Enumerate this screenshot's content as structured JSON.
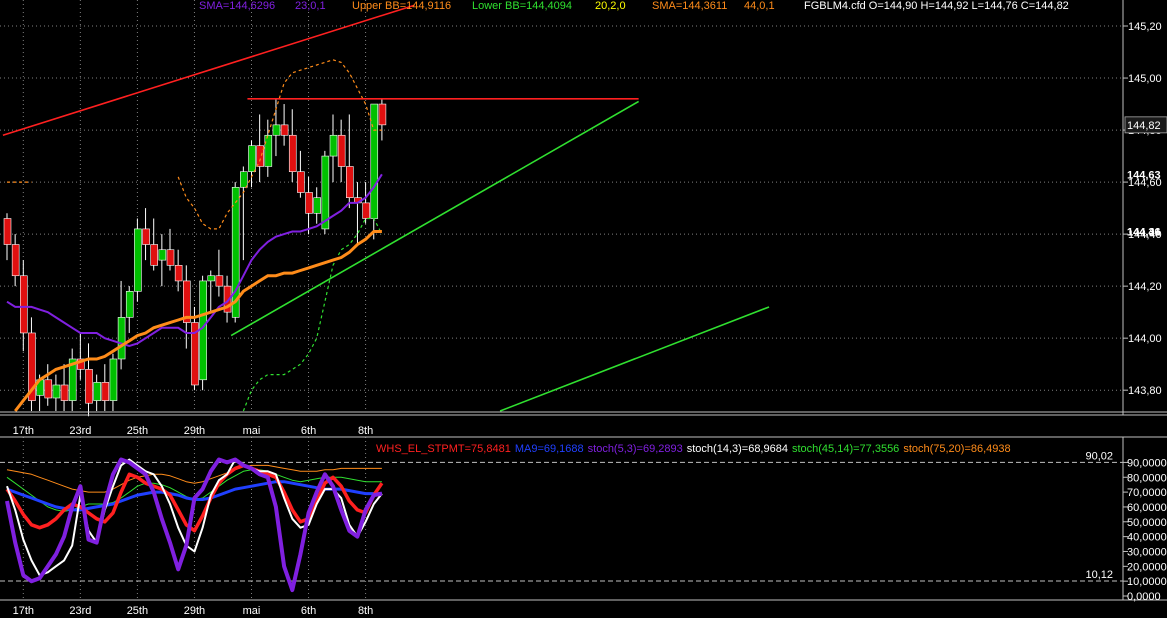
{
  "header": {
    "sma_label": "SMA=144,6296",
    "sma_params": "23,0,1",
    "upper_bb": "Upper BB=144,9116",
    "lower_bb": "Lower BB=144,4094",
    "bb_params": "20,2,0",
    "sma2_label": "SMA=144,3611",
    "sma2_params": "44,0,1",
    "quote": "FGBLM4.cfd O=144,90 H=144,92 L=144,76 C=144,82"
  },
  "colors": {
    "background": "#000000",
    "up_candle": "#00c000",
    "down_candle": "#e01010",
    "sma23": "#8020e0",
    "sma44": "#ff8c1a",
    "bollinger": "#ff8c1a",
    "trend_red": "#ff2020",
    "trend_green": "#30e030",
    "grid": "#808080"
  },
  "chart_data": [
    {
      "type": "candlestick",
      "instrument": "FGBLM4.cfd",
      "ylim": [
        143.72,
        145.3
      ],
      "y_ticks": [
        "145,20",
        "145,00",
        "144,80",
        "144,60",
        "144,40",
        "144,20",
        "144,00",
        "143,80"
      ],
      "x_tick_labels": [
        "17th",
        "23rd",
        "25th",
        "29th",
        "mai",
        "6th",
        "8th"
      ],
      "x_tick_index": [
        2,
        9,
        16,
        23,
        30,
        37,
        44
      ],
      "price_badges": [
        {
          "text": "144,82",
          "value": 144.82,
          "color": "#cccccc"
        },
        {
          "text": "144,63",
          "value": 144.63,
          "color": "#8020e0"
        },
        {
          "text": "144,36",
          "value": 144.41,
          "color": "#ff8c1a"
        },
        {
          "text": "144,41",
          "value": 144.41,
          "color": "#ff8c1a"
        }
      ],
      "ohlc": [
        [
          144.46,
          144.48,
          144.3,
          144.36
        ],
        [
          144.36,
          144.4,
          144.2,
          144.24
        ],
        [
          144.24,
          144.3,
          143.95,
          144.02
        ],
        [
          144.02,
          144.08,
          143.72,
          143.76
        ],
        [
          143.78,
          143.86,
          143.72,
          143.84
        ],
        [
          143.84,
          143.9,
          143.74,
          143.77
        ],
        [
          143.77,
          143.86,
          143.72,
          143.82
        ],
        [
          143.82,
          143.9,
          143.72,
          143.76
        ],
        [
          143.76,
          143.96,
          143.72,
          143.92
        ],
        [
          143.92,
          144.02,
          143.84,
          143.88
        ],
        [
          143.88,
          143.98,
          143.7,
          143.75
        ],
        [
          143.76,
          143.86,
          143.72,
          143.83
        ],
        [
          143.83,
          143.9,
          143.72,
          143.76
        ],
        [
          143.76,
          143.94,
          143.72,
          143.92
        ],
        [
          143.92,
          144.22,
          143.88,
          144.08
        ],
        [
          144.08,
          144.2,
          144.02,
          144.18
        ],
        [
          144.18,
          144.46,
          144.14,
          144.42
        ],
        [
          144.42,
          144.5,
          144.3,
          144.36
        ],
        [
          144.36,
          144.46,
          144.26,
          144.28
        ],
        [
          144.3,
          144.4,
          144.2,
          144.34
        ],
        [
          144.34,
          144.42,
          144.26,
          144.28
        ],
        [
          144.28,
          144.34,
          144.18,
          144.22
        ],
        [
          144.22,
          144.28,
          143.96,
          144.06
        ],
        [
          144.06,
          144.12,
          143.8,
          143.82
        ],
        [
          143.84,
          144.24,
          143.8,
          144.22
        ],
        [
          144.22,
          144.26,
          144.1,
          144.24
        ],
        [
          144.24,
          144.34,
          144.16,
          144.2
        ],
        [
          144.2,
          144.24,
          144.06,
          144.1
        ],
        [
          144.08,
          144.6,
          144.06,
          144.58
        ],
        [
          144.58,
          144.66,
          144.3,
          144.64
        ],
        [
          144.64,
          144.76,
          144.58,
          144.74
        ],
        [
          144.74,
          144.86,
          144.6,
          144.66
        ],
        [
          144.66,
          144.84,
          144.62,
          144.78
        ],
        [
          144.78,
          144.92,
          144.7,
          144.82
        ],
        [
          144.82,
          144.9,
          144.74,
          144.78
        ],
        [
          144.78,
          144.88,
          144.6,
          144.64
        ],
        [
          144.64,
          144.72,
          144.54,
          144.56
        ],
        [
          144.56,
          144.62,
          144.4,
          144.48
        ],
        [
          144.48,
          144.58,
          144.44,
          144.54
        ],
        [
          144.42,
          144.72,
          144.4,
          144.7
        ],
        [
          144.7,
          144.86,
          144.6,
          144.78
        ],
        [
          144.78,
          144.84,
          144.6,
          144.66
        ],
        [
          144.66,
          144.86,
          144.5,
          144.54
        ],
        [
          144.54,
          144.6,
          144.36,
          144.52
        ],
        [
          144.52,
          144.6,
          144.44,
          144.46
        ],
        [
          144.46,
          144.9,
          144.38,
          144.9
        ],
        [
          144.9,
          144.92,
          144.76,
          144.82
        ]
      ],
      "sma_23": [
        144.14,
        144.12,
        144.12,
        144.12,
        144.11,
        144.1,
        144.08,
        144.06,
        144.04,
        144.02,
        144.02,
        144.02,
        144.0,
        143.99,
        143.98,
        143.97,
        143.98,
        144.0,
        144.02,
        144.04,
        144.04,
        144.04,
        144.02,
        144.02,
        144.04,
        144.08,
        144.12,
        144.14,
        144.18,
        144.24,
        144.3,
        144.34,
        144.37,
        144.39,
        144.4,
        144.41,
        144.41,
        144.42,
        144.43,
        144.45,
        144.47,
        144.49,
        144.52,
        144.52,
        144.54,
        144.58,
        144.63
      ],
      "sma_44": [
        null,
        143.72,
        143.76,
        143.8,
        143.84,
        143.86,
        143.88,
        143.89,
        143.9,
        143.91,
        143.92,
        143.92,
        143.93,
        143.95,
        143.97,
        143.99,
        144.01,
        144.02,
        144.04,
        144.05,
        144.06,
        144.07,
        144.08,
        144.08,
        144.09,
        144.1,
        144.11,
        144.12,
        144.14,
        144.18,
        144.2,
        144.22,
        144.24,
        144.24,
        144.25,
        144.25,
        144.26,
        144.27,
        144.28,
        144.29,
        144.3,
        144.31,
        144.33,
        144.36,
        144.38,
        144.41,
        144.41
      ],
      "bb_upper": [
        144.6,
        144.6,
        144.6,
        144.6,
        null,
        null,
        null,
        null,
        null,
        null,
        null,
        null,
        null,
        null,
        null,
        null,
        null,
        null,
        null,
        null,
        null,
        144.62,
        144.54,
        144.5,
        144.44,
        144.42,
        144.42,
        144.48,
        144.52,
        144.56,
        144.62,
        144.68,
        144.78,
        144.88,
        144.98,
        145.02,
        145.03,
        145.04,
        145.05,
        145.06,
        145.07,
        145.06,
        145.02,
        144.96,
        144.9,
        144.8,
        144.8
      ],
      "bb_lower": [
        null,
        null,
        null,
        null,
        null,
        null,
        null,
        null,
        null,
        null,
        null,
        null,
        null,
        null,
        null,
        null,
        null,
        null,
        null,
        null,
        null,
        null,
        null,
        null,
        null,
        null,
        null,
        null,
        null,
        143.72,
        143.8,
        143.84,
        143.86,
        143.86,
        143.86,
        143.88,
        143.9,
        143.94,
        144.0,
        144.14,
        144.28,
        144.34,
        144.36,
        144.4,
        144.46,
        144.46,
        144.4
      ],
      "trendlines": [
        {
          "color": "red",
          "points": [
            [
              -0.5,
              144.78
            ],
            [
              50,
              145.28
            ]
          ]
        },
        {
          "color": "red",
          "points": [
            [
              29.5,
              144.92
            ],
            [
              77.5,
              144.92
            ]
          ]
        },
        {
          "color": "green",
          "points": [
            [
              27.5,
              144.01
            ],
            [
              77.5,
              144.91
            ]
          ]
        },
        {
          "color": "green",
          "points": [
            [
              60.5,
              143.72
            ],
            [
              93.5,
              144.12
            ]
          ]
        }
      ]
    },
    {
      "type": "line",
      "legend": [
        {
          "text": "WHS_EL_STPMT=75,8481",
          "color": "#ff2020"
        },
        {
          "text": "MA9=69,1688",
          "color": "#2040ff"
        },
        {
          "text": "stoch(5,3)=69,2893",
          "color": "#8020e0"
        },
        {
          "text": "stoch(14,3)=68,9684",
          "color": "#ffffff"
        },
        {
          "text": "stoch(45,14)=77,3556",
          "color": "#30e030"
        },
        {
          "text": "stoch(75,20)=86,4938",
          "color": "#ff8c1a"
        }
      ],
      "ylim": [
        0,
        95
      ],
      "y_ticks": [
        "90,0000",
        "80,0000",
        "70,0000",
        "60,0000",
        "50,0000",
        "40,0000",
        "30,0000",
        "20,0000",
        "10,0000",
        "0,0000"
      ],
      "levels": [
        {
          "value": 90.02,
          "label": "90,02"
        },
        {
          "value": 10.12,
          "label": "10,12"
        }
      ],
      "series": [
        {
          "name": "stoch(75,20)",
          "color": "#ff8c1a",
          "values": [
            85,
            84,
            83,
            82,
            80,
            78,
            76,
            74,
            72,
            71,
            70,
            70,
            70,
            72,
            75,
            78,
            80,
            81,
            82,
            82,
            81,
            79,
            77,
            76,
            77,
            79,
            81,
            83,
            85,
            87,
            88,
            88,
            88,
            87,
            86,
            85,
            84,
            84,
            84,
            85,
            85,
            86,
            86,
            86,
            86,
            86,
            86
          ]
        },
        {
          "name": "stoch(45,14)",
          "color": "#30e030",
          "values": [
            80,
            76,
            72,
            68,
            64,
            60,
            58,
            57,
            58,
            60,
            62,
            62,
            62,
            63,
            66,
            70,
            74,
            76,
            76,
            75,
            73,
            70,
            67,
            65,
            66,
            70,
            74,
            78,
            81,
            84,
            85,
            85,
            84,
            82,
            80,
            78,
            77,
            78,
            79,
            80,
            80,
            80,
            79,
            78,
            77,
            77,
            77
          ]
        },
        {
          "name": "MA9",
          "color": "#2040ff",
          "values": [
            72,
            70,
            68,
            66,
            64,
            62,
            60,
            59,
            58,
            58,
            59,
            60,
            61,
            62,
            64,
            66,
            68,
            69,
            70,
            70,
            69,
            68,
            66,
            65,
            65,
            66,
            68,
            70,
            72,
            73,
            74,
            75,
            76,
            77,
            77,
            76,
            75,
            74,
            73,
            72,
            72,
            72,
            71,
            70,
            69,
            69,
            69
          ]
        },
        {
          "name": "WHS_EL_STPMT",
          "color": "#ff2020",
          "values": [
            72,
            64,
            55,
            48,
            46,
            48,
            52,
            58,
            62,
            60,
            56,
            52,
            50,
            56,
            70,
            82,
            80,
            76,
            74,
            72,
            68,
            58,
            48,
            44,
            54,
            66,
            76,
            82,
            86,
            88,
            86,
            84,
            82,
            80,
            70,
            58,
            50,
            52,
            64,
            76,
            80,
            74,
            64,
            58,
            56,
            68,
            76
          ]
        },
        {
          "name": "stoch(14,3)",
          "color": "#ffffff",
          "values": [
            74,
            58,
            38,
            24,
            14,
            16,
            20,
            24,
            34,
            68,
            44,
            36,
            58,
            74,
            88,
            92,
            88,
            84,
            82,
            74,
            62,
            46,
            34,
            30,
            46,
            68,
            78,
            82,
            92,
            88,
            86,
            84,
            84,
            82,
            66,
            52,
            46,
            48,
            62,
            72,
            72,
            66,
            48,
            40,
            50,
            62,
            69
          ]
        },
        {
          "name": "stoch(5,3)",
          "color": "#8020e0",
          "values": [
            64,
            36,
            14,
            10,
            12,
            20,
            28,
            40,
            60,
            74,
            38,
            36,
            62,
            82,
            92,
            90,
            86,
            82,
            70,
            52,
            36,
            18,
            34,
            66,
            72,
            84,
            92,
            90,
            92,
            88,
            86,
            82,
            80,
            60,
            20,
            4,
            28,
            56,
            70,
            82,
            74,
            58,
            44,
            40,
            58,
            68,
            69
          ]
        }
      ]
    }
  ]
}
